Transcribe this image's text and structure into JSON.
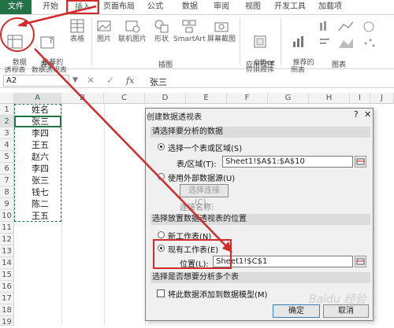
{
  "ribbon_tabs": [
    "文件",
    "开始",
    "插入",
    "页面布局",
    "公式",
    "数据",
    "审阅",
    "视图",
    "开发工具",
    "加载项"
  ],
  "ribbon": {
    "table_group": {
      "buttons": [
        "数据\n透视表",
        "推荐的\n数据透视表",
        "表格"
      ],
      "label": "表格"
    },
    "illustrations_group": {
      "buttons": [
        "图片",
        "联机图片",
        "形状",
        "SmartArt",
        "屏幕截图"
      ],
      "label": "插图"
    },
    "apps_group": {
      "buttons": [
        "Office\n应用程序"
      ],
      "label": "应用程序"
    },
    "charts_group": {
      "buttons": [
        "推荐的\n图表"
      ],
      "label": "图表"
    }
  },
  "formula_bar": {
    "name_box": "A2",
    "fx": "fx",
    "value": "张三"
  },
  "columns": [
    "A",
    "B",
    "C",
    "D",
    "E",
    "F",
    "G",
    "H",
    "I",
    "J"
  ],
  "rows": [
    "1",
    "2",
    "3",
    "4",
    "5",
    "6",
    "7",
    "8",
    "9",
    "10",
    "11",
    "12",
    "13",
    "14",
    "15",
    "16",
    "17",
    "18",
    "19"
  ],
  "cells_A": [
    "姓名",
    "张三",
    "李四",
    "王五",
    "赵六",
    "李四",
    "张三",
    "钱七",
    "陈二",
    "王五"
  ],
  "dialog": {
    "title": "创建数据透视表",
    "section1": "请选择要分析的数据",
    "opt_range": "选择一个表或区域(S)",
    "range_label": "表/区域(T):",
    "range_value": "Sheet1!$A$1:$A$10",
    "opt_external": "使用外部数据源(U)",
    "choose_conn": "选择连接(C)...",
    "conn_name": "连接名称:",
    "section2": "选择放置数据透视表的位置",
    "opt_new": "新工作表(N)",
    "opt_existing": "现有工作表(E)",
    "location_label": "位置(L):",
    "location_value": "Sheet1!$C$1",
    "section3": "选择是否想要分析多个表",
    "checkbox_label": "将此数据添加到数据模型(M)",
    "ok": "确定",
    "cancel": "取消"
  },
  "watermark": "Baidu 经验",
  "colors": {
    "excel_green": "#217346",
    "annotation_red": "#d12b2b"
  }
}
